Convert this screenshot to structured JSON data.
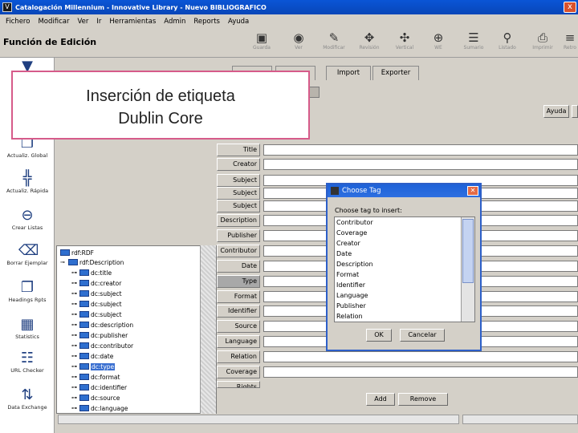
{
  "window": {
    "title": "Catalogación Millennium - Innovative Library - Nuevo BIBLIOGRAFICO",
    "close": "x"
  },
  "menu": [
    "Fichero",
    "Modificar",
    "Ver",
    "Ir",
    "Herramientas",
    "Admin",
    "Reports",
    "Ayuda"
  ],
  "toolbar": {
    "page_title": "Función de Edición",
    "buttons": [
      {
        "label": "Guarda",
        "icon": "floppy-disk-icon"
      },
      {
        "label": "Ver",
        "icon": "eye-icon"
      },
      {
        "label": "Modificar",
        "icon": "edit-pencil-icon"
      },
      {
        "label": "Revisión",
        "icon": "puzzle-icon"
      },
      {
        "label": "Vertical",
        "icon": "vertical-icon"
      },
      {
        "label": "WE",
        "icon": "globe-icon"
      },
      {
        "label": "Sumario",
        "icon": "summary-icon"
      },
      {
        "label": "Listado",
        "icon": "magnifier-icon"
      },
      {
        "label": "Imprimir",
        "icon": "printer-icon"
      },
      {
        "label": "Retro",
        "icon": "retro-icon"
      }
    ]
  },
  "left_panel": [
    {
      "label": "Actualiz. Global",
      "icon": "global-update-icon"
    },
    {
      "label": "Actualiz. Rápida",
      "icon": "rapid-update-icon"
    },
    {
      "label": "Crear Listas",
      "icon": "create-lists-icon"
    },
    {
      "label": "Borrar Ejemplar",
      "icon": "delete-item-icon"
    },
    {
      "label": "Headings Rpts",
      "icon": "headings-reports-icon"
    },
    {
      "label": "Statistics",
      "icon": "statistics-icon"
    },
    {
      "label": "URL Checker",
      "icon": "url-checker-icon"
    },
    {
      "label": "Data Exchange",
      "icon": "data-exchange-icon"
    }
  ],
  "main": {
    "tabs": [
      "Import",
      "Exporter"
    ],
    "help_button": "Ayuda",
    "tree": {
      "root": "rdf:RDF",
      "description": "rdf:Description",
      "items": [
        "dc:title",
        "dc:creator",
        "dc:subject",
        "dc:subject",
        "dc:subject",
        "dc:description",
        "dc:publisher",
        "dc:contributor",
        "dc:date",
        "dc:type",
        "dc:format",
        "dc:identifier",
        "dc:source",
        "dc:language"
      ],
      "selected_index": 9
    },
    "fields": [
      "Title",
      "Creator",
      "Subject",
      "Subject",
      "Subject",
      "Description",
      "Publisher",
      "Contributor",
      "Date",
      "Type",
      "Format",
      "Identifier",
      "Source",
      "Language",
      "Relation",
      "Coverage",
      "Rights"
    ],
    "active_field_index": 9,
    "add_button": "Add",
    "remove_button": "Remove"
  },
  "dialog": {
    "title": "Choose Tag",
    "prompt": "Choose tag to insert:",
    "options": [
      "Contributor",
      "Coverage",
      "Creator",
      "Date",
      "Description",
      "Format",
      "Identifier",
      "Language",
      "Publisher",
      "Relation"
    ],
    "ok": "OK",
    "cancel": "Cancelar"
  },
  "annotation": {
    "line1": "Inserción de etiqueta",
    "line2": "Dublin Core"
  },
  "colors": {
    "titlebar": "#0846b8",
    "chrome": "#d4d0c8",
    "annotation_border": "#d65b8a",
    "selection": "#3a6fd0"
  }
}
